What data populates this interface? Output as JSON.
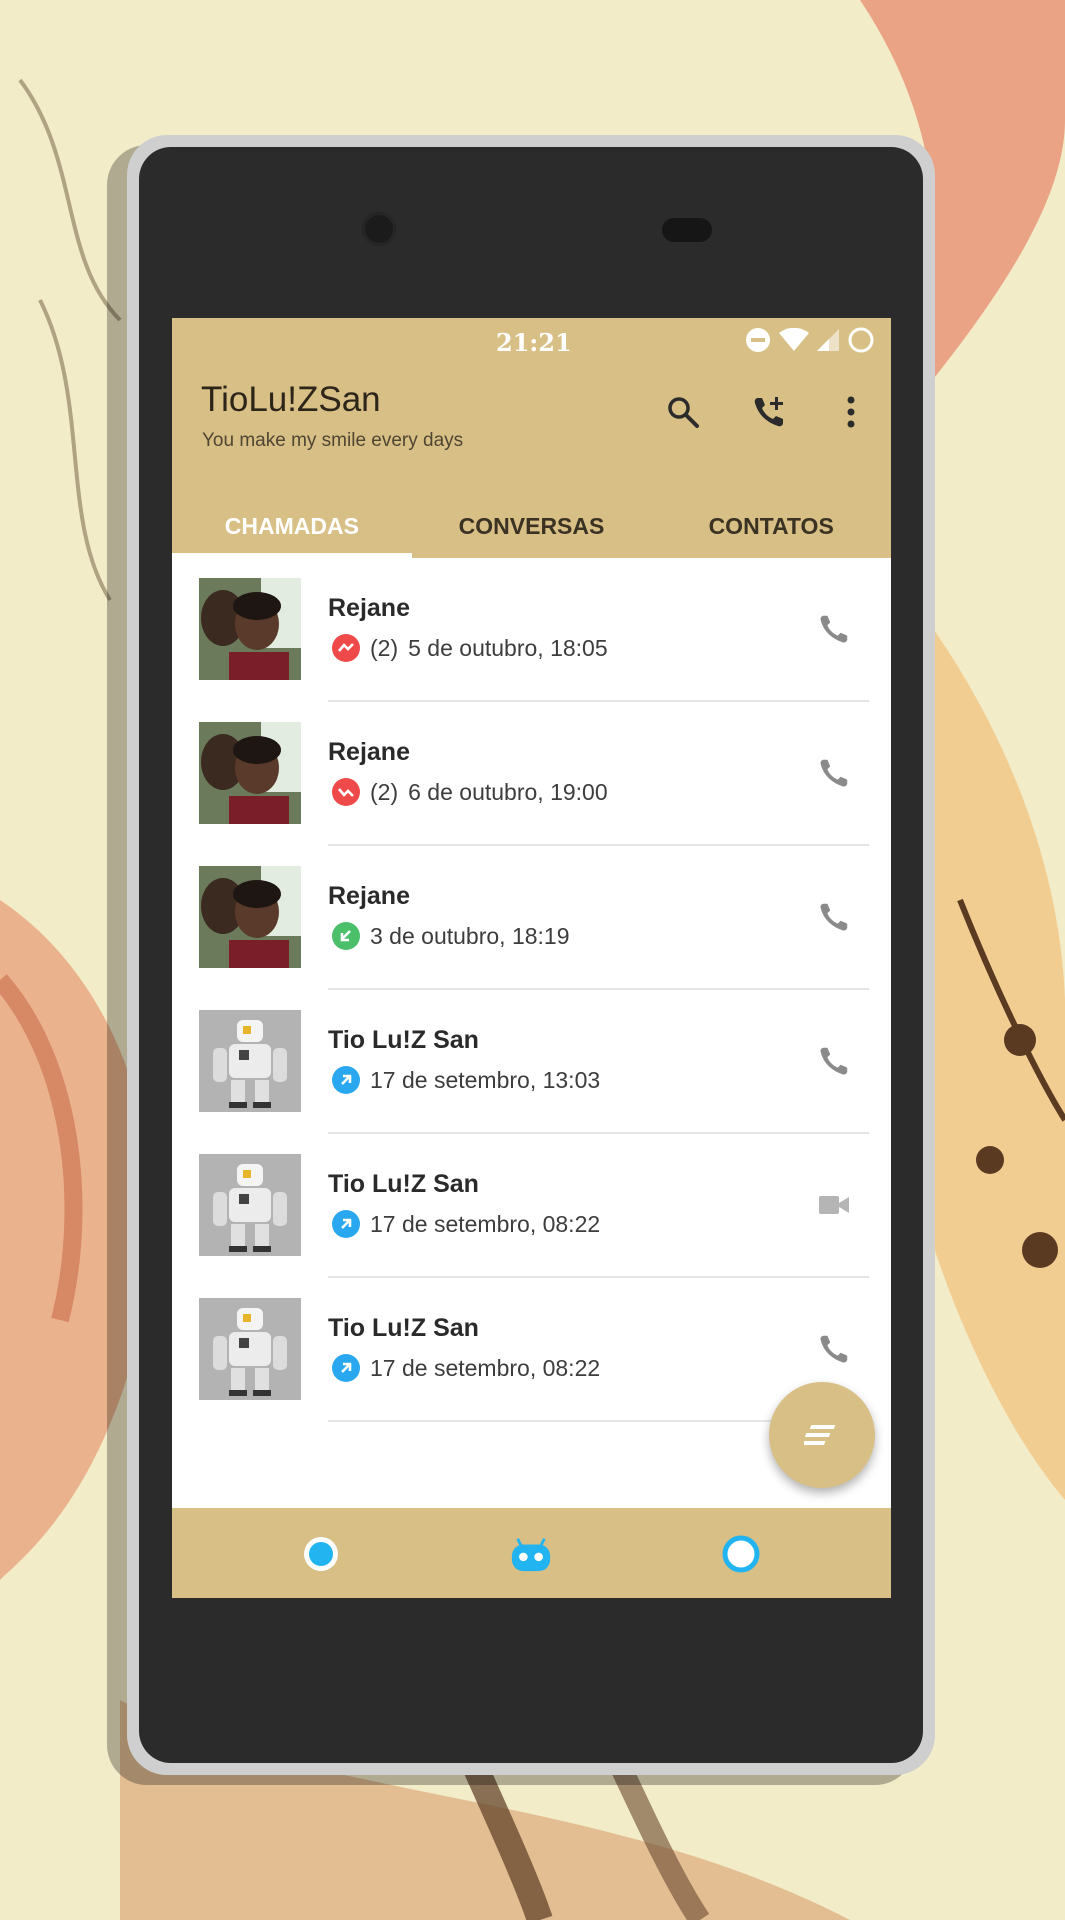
{
  "colors": {
    "accent": "#d8bf85",
    "missed": "#ef4a4a",
    "received": "#4cbf6a",
    "outgoing": "#29a8ef",
    "nav_icon": "#22b4f0"
  },
  "status_bar": {
    "time": "21:21",
    "icons": [
      "dnd-icon",
      "wifi-icon",
      "signal-icon",
      "battery-icon"
    ]
  },
  "header": {
    "title": "TioLu!ZSan",
    "subtitle": "You make my smile every days",
    "actions": [
      "search-icon",
      "add-call-icon",
      "more-vert-icon"
    ]
  },
  "tabs": [
    {
      "label": "CHAMADAS",
      "active": true
    },
    {
      "label": "CONVERSAS",
      "active": false
    },
    {
      "label": "CONTATOS",
      "active": false
    }
  ],
  "calls": [
    {
      "name": "Rejane",
      "type": "missed",
      "count": "(2)",
      "time": "5 de outubro, 18:05",
      "action": "phone-icon"
    },
    {
      "name": "Rejane",
      "type": "missed",
      "count": "(2)",
      "time": "6 de outubro, 19:00",
      "action": "phone-icon"
    },
    {
      "name": "Rejane",
      "type": "received",
      "count": "",
      "time": "3 de outubro, 18:19",
      "action": "phone-icon"
    },
    {
      "name": "Tio Lu!Z San",
      "type": "outgoing",
      "count": "",
      "time": "17 de setembro, 13:03",
      "action": "phone-icon"
    },
    {
      "name": "Tio Lu!Z San",
      "type": "outgoing",
      "count": "",
      "time": "17 de setembro, 08:22",
      "action": "videocam-icon"
    },
    {
      "name": "Tio Lu!Z San",
      "type": "outgoing",
      "count": "",
      "time": "17 de setembro, 08:22",
      "action": "phone-icon"
    }
  ],
  "fab": {
    "icon": "dialpad-lines-icon"
  },
  "navbar": {
    "icons": [
      "back-dot-icon",
      "robot-home-icon",
      "recents-ring-icon"
    ]
  }
}
